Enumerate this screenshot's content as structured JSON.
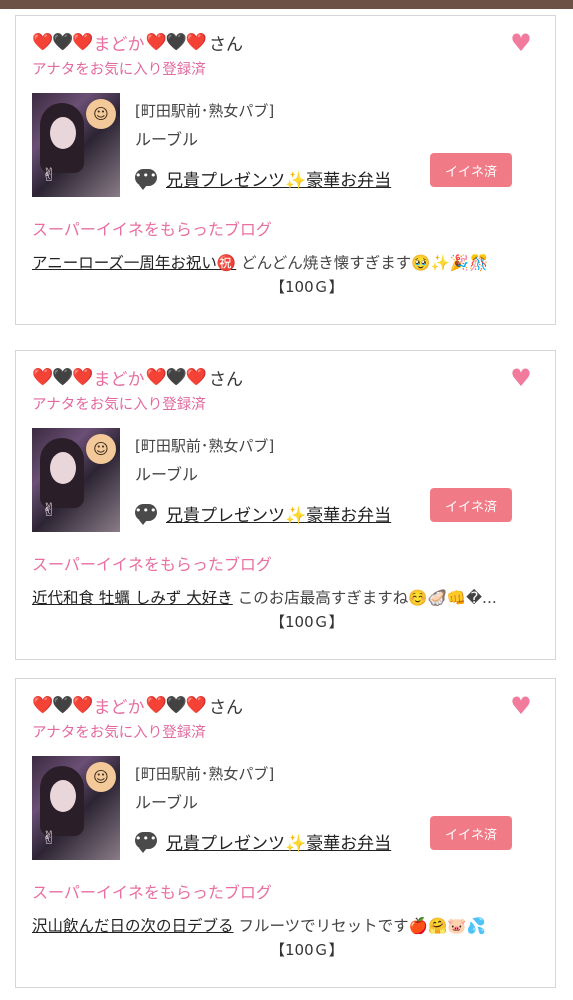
{
  "colors": {
    "topbar": "#6b5244",
    "accent_pink": "#e86fa0",
    "button": "#f07b87",
    "fav_heart": "#f07b9c"
  },
  "cards": [
    {
      "hearts_left": "❤️🖤❤️",
      "name": "まどか",
      "hearts_right": "❤️🖤❤️",
      "honorific": "さん",
      "fav_icon": "heart-icon",
      "fav_status": "アナタをお気に入り登録済",
      "area": "[町田駅前･熟女パブ]",
      "shop": "ルーブル",
      "bubble_icon": "speech-bubble-icon",
      "present_link": "兄貴プレゼンツ✨豪華お弁当",
      "iine_button": "イイネ済",
      "blog_heading": "スーパーイイネをもらったブログ",
      "blog_title": "アニーローズ一周年お祝い㊗️",
      "blog_snippet": "どんどん焼き懐すぎます🥹✨🎉🎊",
      "blog_price": "【100Ｇ】"
    },
    {
      "hearts_left": "❤️🖤❤️",
      "name": "まどか",
      "hearts_right": "❤️🖤❤️",
      "honorific": "さん",
      "fav_icon": "heart-icon",
      "fav_status": "アナタをお気に入り登録済",
      "area": "[町田駅前･熟女パブ]",
      "shop": "ルーブル",
      "bubble_icon": "speech-bubble-icon",
      "present_link": "兄貴プレゼンツ✨豪華お弁当",
      "iine_button": "イイネ済",
      "blog_heading": "スーパーイイネをもらったブログ",
      "blog_title": "近代和食 牡蠣 しみず 大好き",
      "blog_snippet": "このお店最高すぎますね☺️🦪👊�...",
      "blog_price": "【100Ｇ】"
    },
    {
      "hearts_left": "❤️🖤❤️",
      "name": "まどか",
      "hearts_right": "❤️🖤❤️",
      "honorific": "さん",
      "fav_icon": "heart-icon",
      "fav_status": "アナタをお気に入り登録済",
      "area": "[町田駅前･熟女パブ]",
      "shop": "ルーブル",
      "bubble_icon": "speech-bubble-icon",
      "present_link": "兄貴プレゼンツ✨豪華お弁当",
      "iine_button": "イイネ済",
      "blog_heading": "スーパーイイネをもらったブログ",
      "blog_title": "沢山飲んだ日の次の日デブる",
      "blog_snippet": "フルーツでリセットです🍎🤗🐷💦",
      "blog_price": "【100Ｇ】"
    }
  ]
}
